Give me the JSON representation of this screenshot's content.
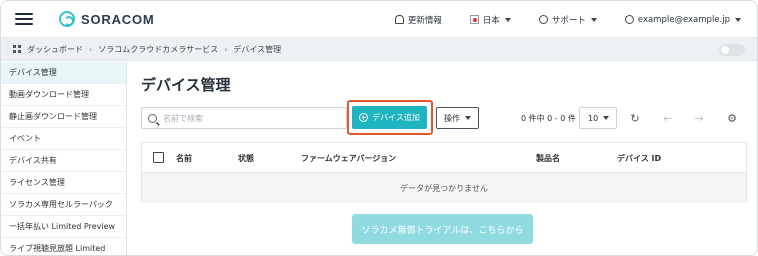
{
  "header": {
    "brand": "SORACOM",
    "nav": {
      "news": "更新情報",
      "language": "日本",
      "support": "サポート",
      "account": "example@example.jp"
    }
  },
  "breadcrumb": {
    "items": [
      "ダッシュボード",
      "ソラコムクラウドカメラサービス",
      "デバイス管理"
    ]
  },
  "sidebar": {
    "items": [
      {
        "label": "デバイス管理"
      },
      {
        "label": "動画ダウンロード管理"
      },
      {
        "label": "静止画ダウンロード管理"
      },
      {
        "label": "イベント"
      },
      {
        "label": "デバイス共有"
      },
      {
        "label": "ライセンス管理"
      },
      {
        "label": "ソラカメ専用セルラーパック"
      },
      {
        "label": "一括年払い Limited Preview"
      },
      {
        "label": "ライブ視聴見放題 Limited"
      }
    ]
  },
  "main": {
    "title": "デバイス管理",
    "search": {
      "placeholder": "名前で検索",
      "value": ""
    },
    "add_device_label": "デバイス追加",
    "operations_label": "操作",
    "count_text": "0 件中 0 - 0 件",
    "page_size": "10",
    "table": {
      "columns": [
        "名前",
        "状態",
        "ファームウェアバージョン",
        "製品名",
        "デバイス ID"
      ],
      "empty_message": "データが見つかりません"
    },
    "trial_label": "ソラカメ無償トライアルは、こちらから"
  },
  "colors": {
    "accent": "#1fb5c0",
    "highlight": "#e4572b",
    "trial_button": "#8fdbe0"
  }
}
